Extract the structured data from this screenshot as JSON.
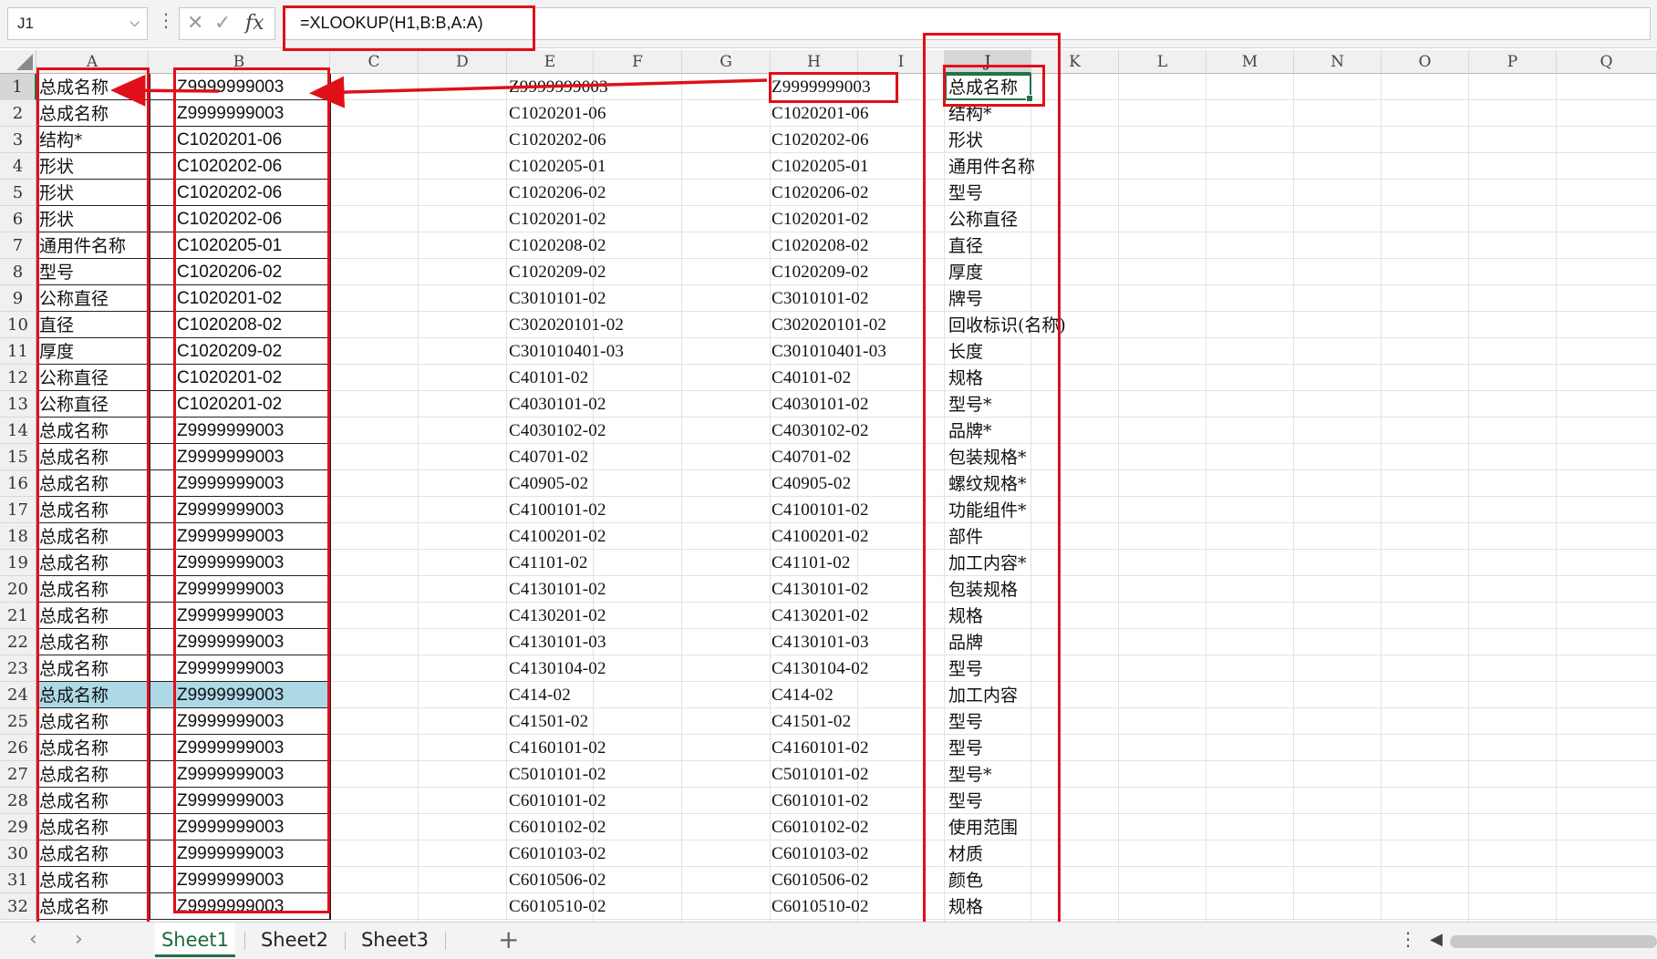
{
  "name_box": "J1",
  "formula": "=XLOOKUP(H1,B:B,A:A)",
  "formula_bar_icons": [
    "chevron-down-icon",
    "more-icon",
    "cancel-icon",
    "enter-icon",
    "fx-icon"
  ],
  "selected_cell": {
    "column": "J",
    "row": 1
  },
  "highlighted_row": 24,
  "columns": [
    "A",
    "B",
    "C",
    "D",
    "E",
    "F",
    "G",
    "H",
    "I",
    "J",
    "K",
    "L",
    "M",
    "N",
    "O",
    "P",
    "Q"
  ],
  "rows": [
    {
      "n": "1",
      "a": "总成名称",
      "b": "Z9999999003",
      "e": "Z9999999003",
      "h": "Z9999999003",
      "j": "总成名称"
    },
    {
      "n": "2",
      "a": "总成名称",
      "b": "Z9999999003",
      "e": "C1020201-06",
      "h": "C1020201-06",
      "j": "结构*"
    },
    {
      "n": "3",
      "a": "结构*",
      "b": "C1020201-06",
      "e": "C1020202-06",
      "h": "C1020202-06",
      "j": "形状"
    },
    {
      "n": "4",
      "a": "形状",
      "b": "C1020202-06",
      "e": "C1020205-01",
      "h": "C1020205-01",
      "j": "通用件名称"
    },
    {
      "n": "5",
      "a": "形状",
      "b": "C1020202-06",
      "e": "C1020206-02",
      "h": "C1020206-02",
      "j": "型号"
    },
    {
      "n": "6",
      "a": "形状",
      "b": "C1020202-06",
      "e": "C1020201-02",
      "h": "C1020201-02",
      "j": "公称直径"
    },
    {
      "n": "7",
      "a": "通用件名称",
      "b": "C1020205-01",
      "e": "C1020208-02",
      "h": "C1020208-02",
      "j": "直径"
    },
    {
      "n": "8",
      "a": "型号",
      "b": "C1020206-02",
      "e": "C1020209-02",
      "h": "C1020209-02",
      "j": "厚度"
    },
    {
      "n": "9",
      "a": "公称直径",
      "b": "C1020201-02",
      "e": "C3010101-02",
      "h": "C3010101-02",
      "j": "牌号"
    },
    {
      "n": "10",
      "a": "直径",
      "b": "C1020208-02",
      "e": "C302020101-02",
      "h": "C302020101-02",
      "j": "回收标识(名称)"
    },
    {
      "n": "11",
      "a": "厚度",
      "b": "C1020209-02",
      "e": "C301010401-03",
      "h": "C301010401-03",
      "j": "长度"
    },
    {
      "n": "12",
      "a": "公称直径",
      "b": "C1020201-02",
      "e": "C40101-02",
      "h": "C40101-02",
      "j": "规格"
    },
    {
      "n": "13",
      "a": "公称直径",
      "b": "C1020201-02",
      "e": "C4030101-02",
      "h": "C4030101-02",
      "j": "型号*"
    },
    {
      "n": "14",
      "a": "总成名称",
      "b": "Z9999999003",
      "e": "C4030102-02",
      "h": "C4030102-02",
      "j": "品牌*"
    },
    {
      "n": "15",
      "a": "总成名称",
      "b": "Z9999999003",
      "e": "C40701-02",
      "h": "C40701-02",
      "j": "包装规格*"
    },
    {
      "n": "16",
      "a": "总成名称",
      "b": "Z9999999003",
      "e": "C40905-02",
      "h": "C40905-02",
      "j": "螺纹规格*"
    },
    {
      "n": "17",
      "a": "总成名称",
      "b": "Z9999999003",
      "e": "C4100101-02",
      "h": "C4100101-02",
      "j": "功能组件*"
    },
    {
      "n": "18",
      "a": "总成名称",
      "b": "Z9999999003",
      "e": "C4100201-02",
      "h": "C4100201-02",
      "j": "部件"
    },
    {
      "n": "19",
      "a": "总成名称",
      "b": "Z9999999003",
      "e": "C41101-02",
      "h": "C41101-02",
      "j": "加工内容*"
    },
    {
      "n": "20",
      "a": "总成名称",
      "b": "Z9999999003",
      "e": "C4130101-02",
      "h": "C4130101-02",
      "j": "包装规格"
    },
    {
      "n": "21",
      "a": "总成名称",
      "b": "Z9999999003",
      "e": "C4130201-02",
      "h": "C4130201-02",
      "j": "规格"
    },
    {
      "n": "22",
      "a": "总成名称",
      "b": "Z9999999003",
      "e": "C4130101-03",
      "h": "C4130101-03",
      "j": "品牌"
    },
    {
      "n": "23",
      "a": "总成名称",
      "b": "Z9999999003",
      "e": "C4130104-02",
      "h": "C4130104-02",
      "j": "型号"
    },
    {
      "n": "24",
      "a": "总成名称",
      "b": "Z9999999003",
      "e": "C414-02",
      "h": "C414-02",
      "j": "加工内容"
    },
    {
      "n": "25",
      "a": "总成名称",
      "b": "Z9999999003",
      "e": "C41501-02",
      "h": "C41501-02",
      "j": "型号"
    },
    {
      "n": "26",
      "a": "总成名称",
      "b": "Z9999999003",
      "e": "C4160101-02",
      "h": "C4160101-02",
      "j": "型号"
    },
    {
      "n": "27",
      "a": "总成名称",
      "b": "Z9999999003",
      "e": "C5010101-02",
      "h": "C5010101-02",
      "j": "型号*"
    },
    {
      "n": "28",
      "a": "总成名称",
      "b": "Z9999999003",
      "e": "C6010101-02",
      "h": "C6010101-02",
      "j": "型号"
    },
    {
      "n": "29",
      "a": "总成名称",
      "b": "Z9999999003",
      "e": "C6010102-02",
      "h": "C6010102-02",
      "j": "使用范围"
    },
    {
      "n": "30",
      "a": "总成名称",
      "b": "Z9999999003",
      "e": "C6010103-02",
      "h": "C6010103-02",
      "j": "材质"
    },
    {
      "n": "31",
      "a": "总成名称",
      "b": "Z9999999003",
      "e": "C6010506-02",
      "h": "C6010506-02",
      "j": "颜色"
    },
    {
      "n": "32",
      "a": "总成名称",
      "b": "Z9999999003",
      "e": "C6010510-02",
      "h": "C6010510-02",
      "j": "规格"
    }
  ],
  "sheet_tabs": [
    {
      "label": "Sheet1",
      "active": true
    },
    {
      "label": "Sheet2",
      "active": false
    },
    {
      "label": "Sheet3",
      "active": false
    }
  ],
  "add_sheet": "+",
  "nav_prev": "‹",
  "nav_next": "›",
  "annotation_color": "#e0101a",
  "accent_color": "#217346",
  "highlight_color": "#add8e6"
}
